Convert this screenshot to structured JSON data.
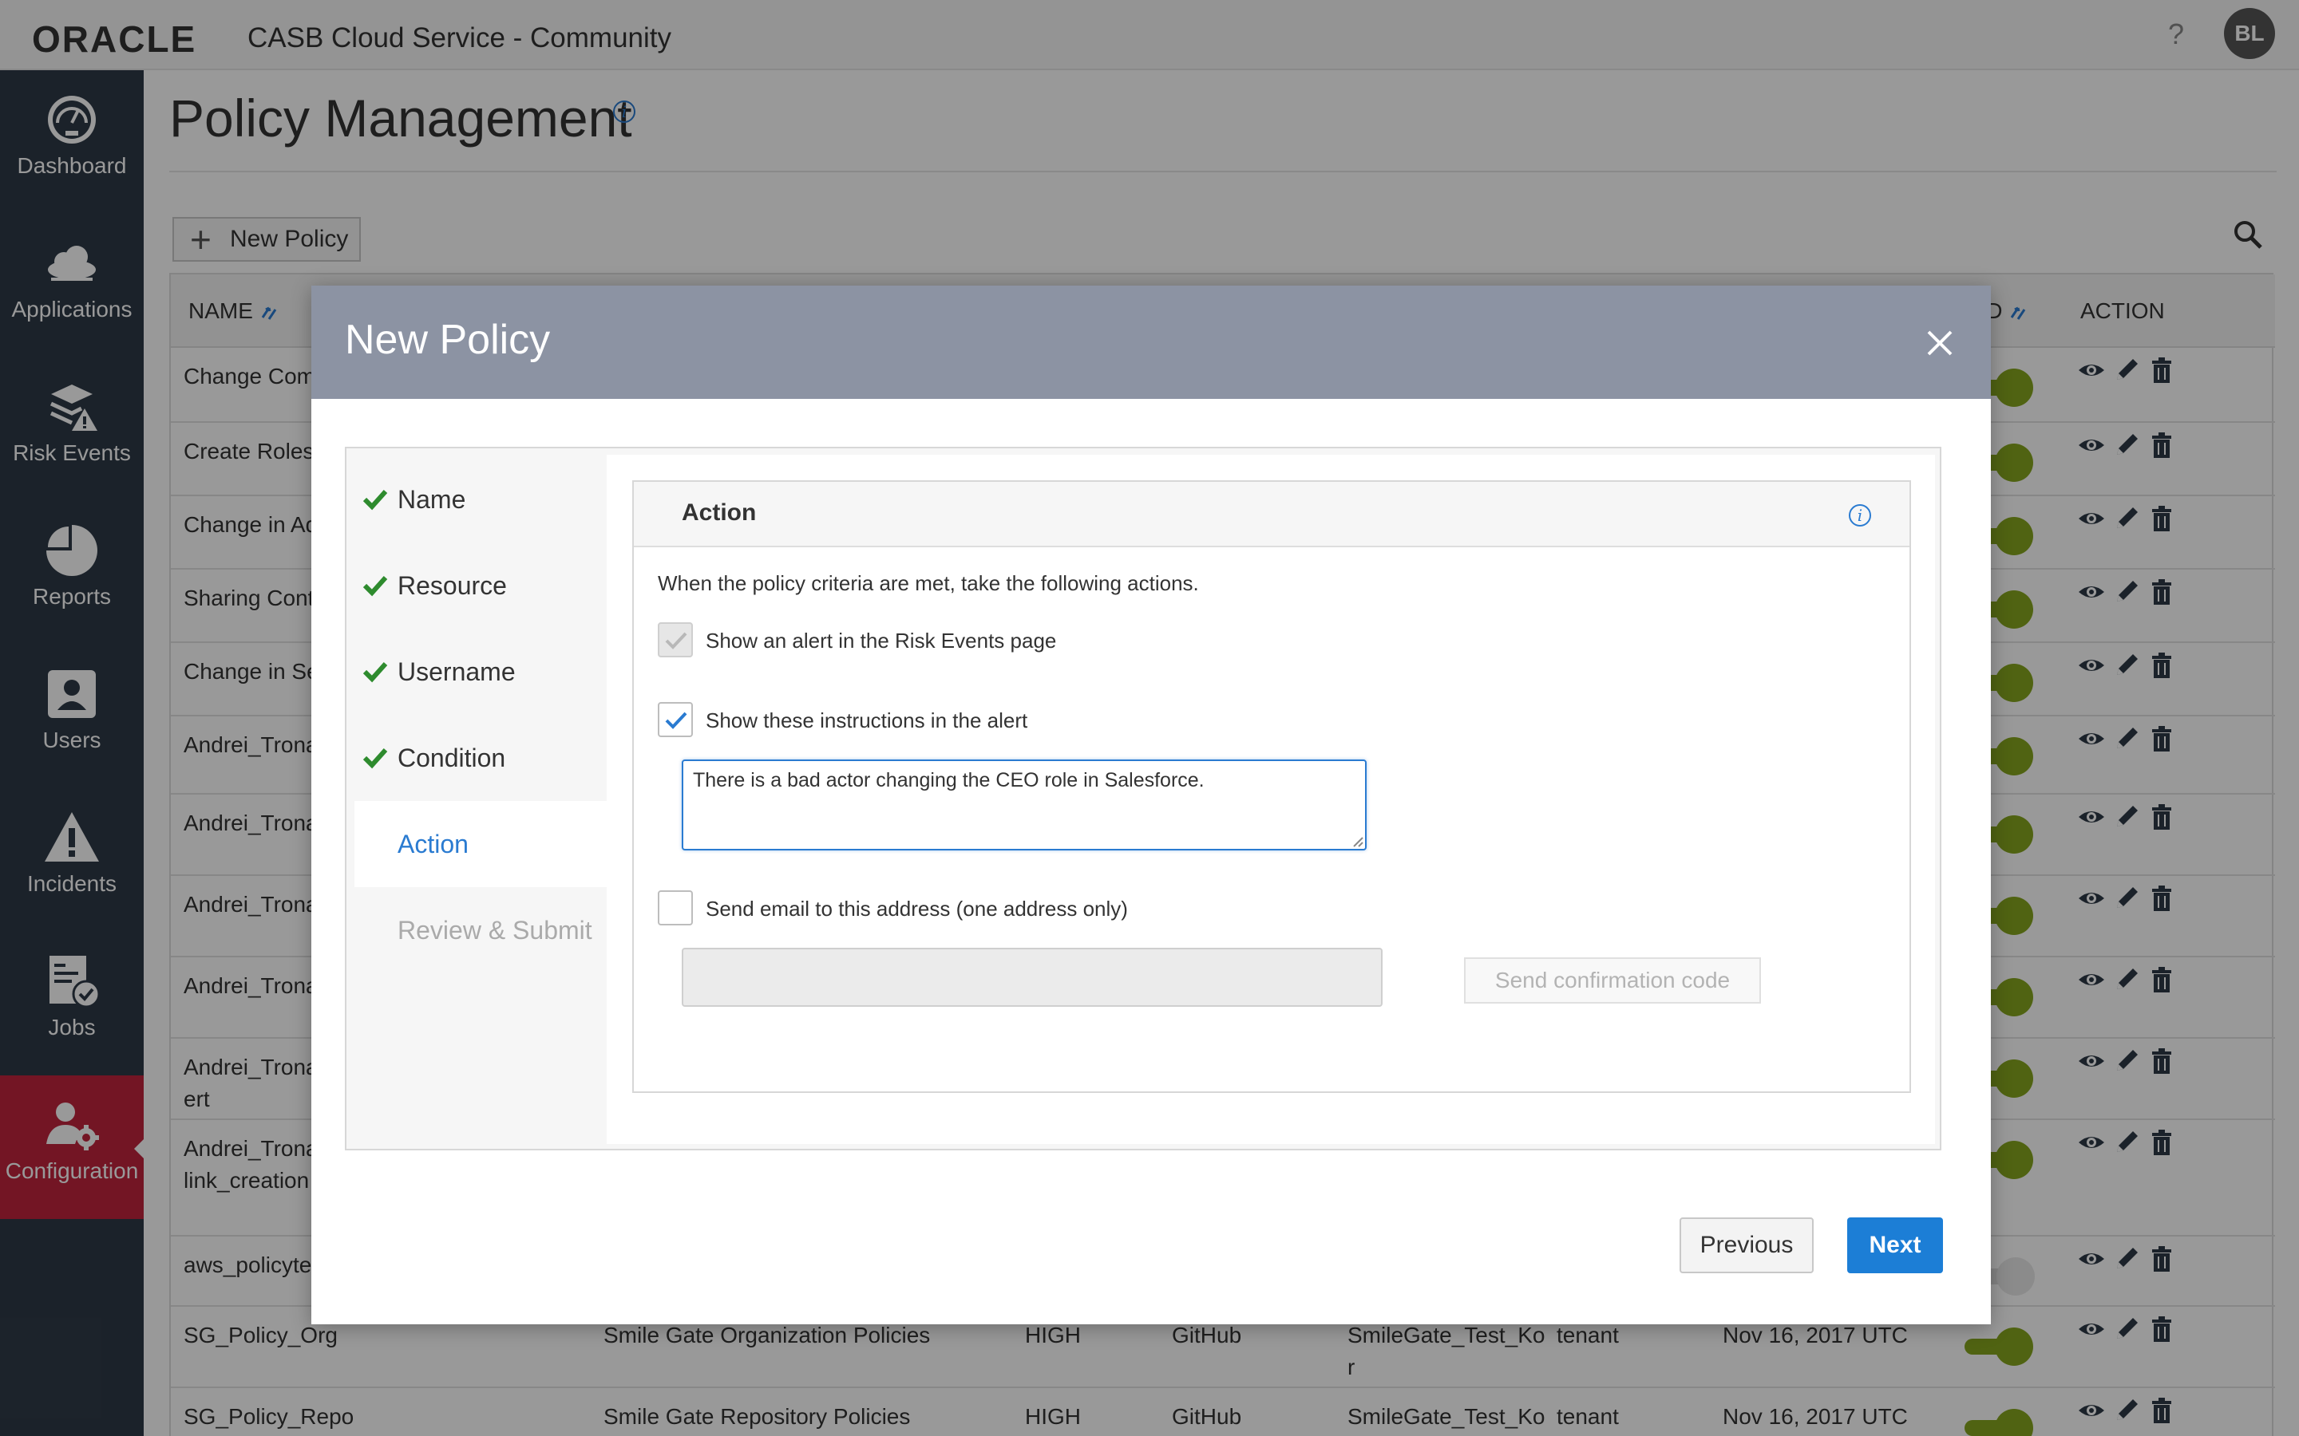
{
  "topbar": {
    "brand": "ORACLE",
    "app_title": "CASB Cloud Service - Community",
    "help": "?",
    "user_initials": "BL"
  },
  "sidebar": {
    "items": [
      {
        "label": "Dashboard",
        "icon": "dashboard-gauge-icon"
      },
      {
        "label": "Applications",
        "icon": "cloud-applications-icon"
      },
      {
        "label": "Risk Events",
        "icon": "risk-events-warning-icon"
      },
      {
        "label": "Reports",
        "icon": "pie-chart-icon"
      },
      {
        "label": "Users",
        "icon": "user-card-icon"
      },
      {
        "label": "Incidents",
        "icon": "warning-triangle-icon"
      },
      {
        "label": "Jobs",
        "icon": "jobs-clipboard-icon"
      },
      {
        "label": "Configuration",
        "icon": "user-gear-icon",
        "active": true
      }
    ]
  },
  "page": {
    "title": "Policy Management",
    "info": "i",
    "new_policy_label": "New Policy"
  },
  "table": {
    "headers": {
      "name": "NAME",
      "enabled": "LED",
      "action": "ACTION"
    },
    "rows": [
      {
        "name": "Change Comp",
        "desc": "",
        "risk": "",
        "app": "",
        "instance": "",
        "scope": "",
        "date": "",
        "enabled": true
      },
      {
        "name": "Create Roles",
        "desc": "",
        "risk": "",
        "app": "",
        "instance": "",
        "scope": "",
        "date": "",
        "enabled": true
      },
      {
        "name": "Change in Ad",
        "desc": "",
        "risk": "",
        "app": "",
        "instance": "",
        "scope": "",
        "date": "",
        "enabled": true
      },
      {
        "name": "Sharing Conte",
        "desc": "",
        "risk": "",
        "app": "",
        "instance": "",
        "scope": "",
        "date": "",
        "enabled": true
      },
      {
        "name": "Change in Sec",
        "desc": "",
        "risk": "",
        "app": "",
        "instance": "",
        "scope": "",
        "date": "",
        "enabled": true
      },
      {
        "name": "Andrei_Trona",
        "desc": "",
        "risk": "",
        "app": "",
        "instance": "",
        "scope": "",
        "date": "",
        "enabled": true
      },
      {
        "name": "Andrei_Trona",
        "desc": "",
        "risk": "",
        "app": "",
        "instance": "",
        "scope": "",
        "date": "",
        "enabled": true
      },
      {
        "name": "Andrei_Trona",
        "desc": "",
        "risk": "",
        "app": "",
        "instance": "",
        "scope": "",
        "date": "",
        "enabled": true
      },
      {
        "name": "Andrei_Trona",
        "desc": "",
        "risk": "",
        "app": "",
        "instance": "",
        "scope": "",
        "date": "",
        "enabled": true
      },
      {
        "name": "Andrei_Trona",
        "name2": "ert",
        "desc": "",
        "risk": "",
        "app": "",
        "instance": "",
        "scope": "",
        "date": "",
        "enabled": true
      },
      {
        "name": "Andrei_Trona",
        "name2": "link_creation",
        "desc": "",
        "risk": "",
        "app": "",
        "instance": "",
        "scope": "",
        "date": "",
        "enabled": true
      },
      {
        "name": "aws_policytes",
        "desc": "",
        "risk": "",
        "app": "",
        "instance": "",
        "scope": "",
        "date": "",
        "enabled": false
      },
      {
        "name": "SG_Policy_Org",
        "desc": "Smile Gate Organization Policies",
        "risk": "HIGH",
        "app": "GitHub",
        "instance": "SmileGate_Test_Ko",
        "instance2": "r",
        "scope": "tenant",
        "date": "Nov 16, 2017 UTC",
        "enabled": true
      },
      {
        "name": "SG_Policy_Repo",
        "desc": "Smile Gate Repository Policies",
        "risk": "HIGH",
        "app": "GitHub",
        "instance": "SmileGate_Test_Ko",
        "scope": "tenant",
        "date": "Nov 16, 2017 UTC",
        "enabled": true
      }
    ]
  },
  "modal": {
    "title": "New Policy",
    "steps": [
      {
        "label": "Name",
        "state": "done"
      },
      {
        "label": "Resource",
        "state": "done"
      },
      {
        "label": "Username",
        "state": "done"
      },
      {
        "label": "Condition",
        "state": "done"
      },
      {
        "label": "Action",
        "state": "current"
      },
      {
        "label": "Review & Submit",
        "state": "future"
      }
    ],
    "action": {
      "title": "Action",
      "info": "i",
      "intro": "When the policy criteria are met, take the following actions.",
      "alert_label": "Show an alert in the Risk Events page",
      "instructions_label": "Show these instructions in the alert",
      "instructions_value": "There is a bad actor changing the CEO role in Salesforce.",
      "email_label": "Send email to this address (one address only)",
      "email_value": "",
      "send_code_label": "Send confirmation code"
    },
    "previous_label": "Previous",
    "next_label": "Next"
  },
  "colors": {
    "sidebar_bg": "#2e3a47",
    "active_nav": "#c0243c",
    "modal_header": "#8c93a3",
    "primary_blue": "#1c7ed6",
    "check_green": "#2e8b2e",
    "toggle_green": "#85a51e"
  }
}
